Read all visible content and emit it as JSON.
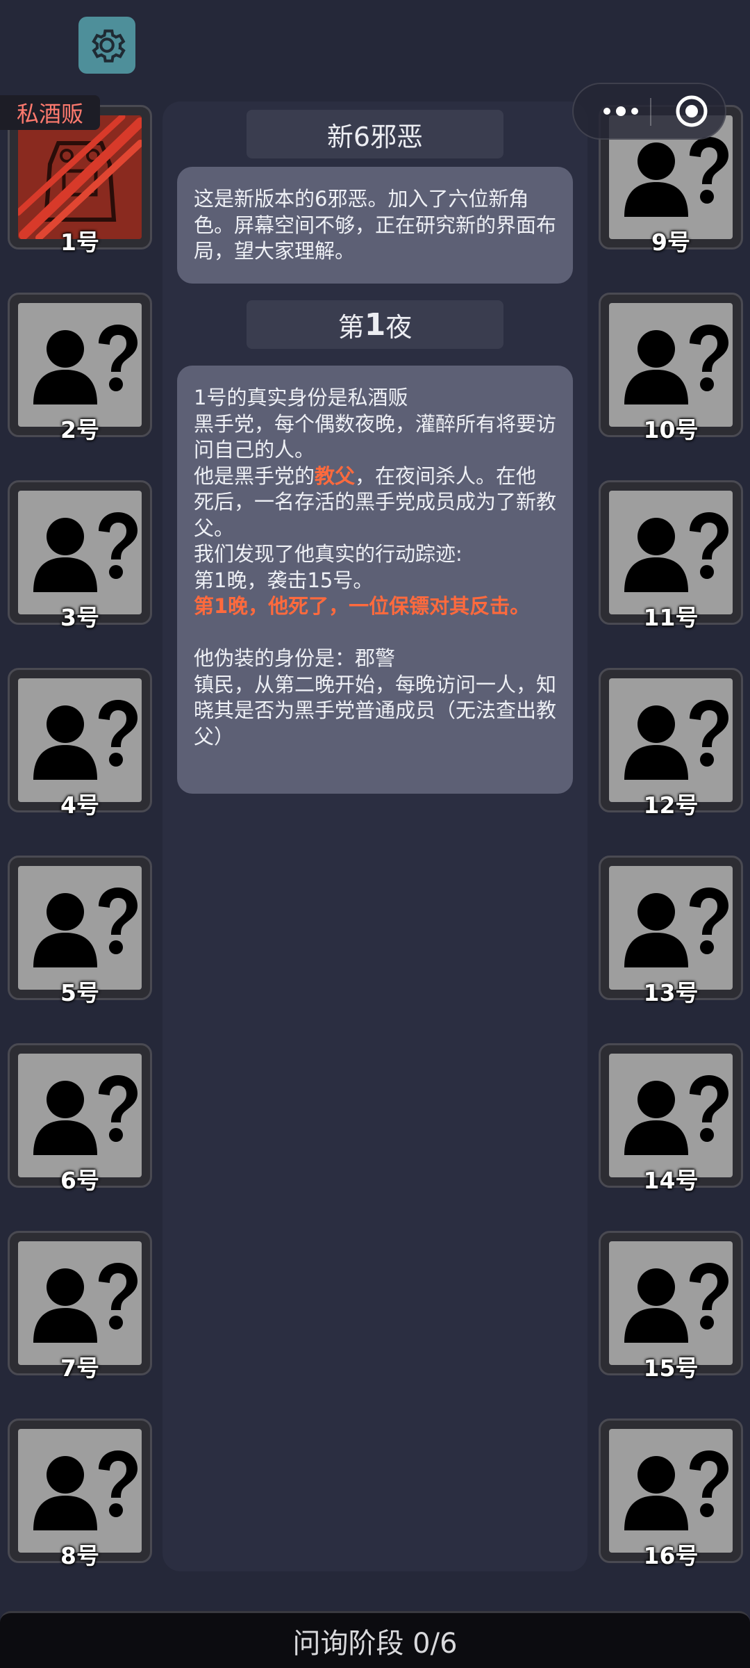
{
  "header": {
    "settings_icon": "gear-icon",
    "capsule": {
      "more_icon": "more-dots-icon",
      "close_icon": "target-circle-icon"
    }
  },
  "intro": {
    "title": "新6邪恶",
    "text": "这是新版本的6邪恶。加入了六位新角色。屏幕空间不够，正在研究新的界面布局，望大家理解。"
  },
  "night": {
    "title_prefix": "第",
    "title_num": "1",
    "title_suffix": "夜",
    "lines_a": "1号的真实身份是私酒贩\n黑手党，每个偶数夜晚，灌醉所有将要访问自己的人。\n他是黑手党的",
    "role_highlight": "教父",
    "lines_b": "，在夜间杀人。在他死后，一名存活的黑手党成员成为了新教父。\n我们发现了他真实的行动踪迹:\n第1晚，袭击15号。\n",
    "death_note": "第1晚，他死了，一位保镖对其反击。",
    "lines_c": "\n\n他伪装的身份是：郡警\n镇民，从第二晚开始，每晚访问一人，知晓其是否为黑手党普通成员（无法查出教父）"
  },
  "players": [
    {
      "label": "1号",
      "icon": "bootlegger-role-icon",
      "role_tag": "私酒贩"
    },
    {
      "label": "2号",
      "icon": "unknown-person-icon"
    },
    {
      "label": "3号",
      "icon": "unknown-person-icon"
    },
    {
      "label": "4号",
      "icon": "unknown-person-icon"
    },
    {
      "label": "5号",
      "icon": "unknown-person-icon"
    },
    {
      "label": "6号",
      "icon": "unknown-person-icon"
    },
    {
      "label": "7号",
      "icon": "unknown-person-icon"
    },
    {
      "label": "8号",
      "icon": "unknown-person-icon"
    },
    {
      "label": "9号",
      "icon": "unknown-person-icon"
    },
    {
      "label": "10号",
      "icon": "unknown-person-icon"
    },
    {
      "label": "11号",
      "icon": "unknown-person-icon"
    },
    {
      "label": "12号",
      "icon": "unknown-person-icon"
    },
    {
      "label": "13号",
      "icon": "unknown-person-icon"
    },
    {
      "label": "14号",
      "icon": "unknown-person-icon"
    },
    {
      "label": "15号",
      "icon": "unknown-person-icon"
    },
    {
      "label": "16号",
      "icon": "unknown-person-icon"
    }
  ],
  "status": {
    "phase_text": "问询阶段 0/6"
  },
  "colors": {
    "background": "#252839",
    "panel": "#2b2e41",
    "message": "#5d6075",
    "highlight": "#ff6a3d",
    "accent": "#4e8f9a"
  }
}
